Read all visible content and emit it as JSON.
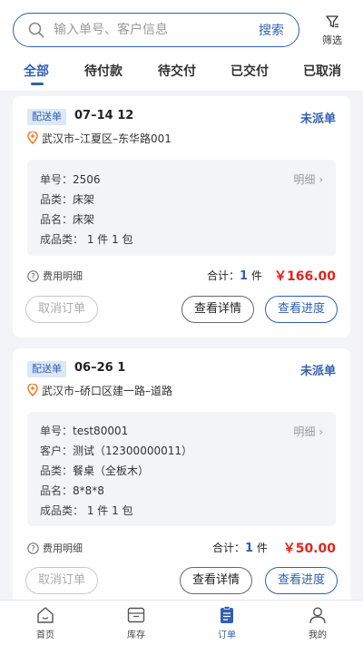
{
  "search": {
    "placeholder": "输入单号、客户信息",
    "button_label": "搜索"
  },
  "filter": {
    "label": "筛选",
    "icon": "filter-icon"
  },
  "tabs": [
    {
      "label": "全部",
      "active": true
    },
    {
      "label": "待付款",
      "active": false
    },
    {
      "label": "待交付",
      "active": false
    },
    {
      "label": "已交付",
      "active": false
    },
    {
      "label": "已取消",
      "active": false
    }
  ],
  "orders": [
    {
      "badge": "配送单",
      "date": "07–14  12",
      "status": "未派单",
      "address": "武汉市–江夏区–东华路001",
      "detail_more": "明细",
      "lines": [
        {
          "label": "单号：",
          "value": "2506"
        },
        {
          "label": "品类：",
          "value": "床架"
        },
        {
          "label": "品名：",
          "value": "床架"
        },
        {
          "label": "成品类：",
          "value": "1 件 1 包"
        }
      ],
      "fee_label": "费用明细",
      "total_label": "合计：",
      "total_count": "1",
      "total_unit": "件",
      "price": "￥166.00",
      "buttons": {
        "cancel": "取消订单",
        "view": "查看详情",
        "progress": "查看进度"
      }
    },
    {
      "badge": "配送单",
      "date": "06–26  1",
      "status": "未派单",
      "address": "武汉市–硚口区建一路–道路",
      "detail_more": "明细",
      "lines": [
        {
          "label": "单号：",
          "value": "test80001"
        },
        {
          "label": "客户：",
          "value": "测试（12300000011）"
        },
        {
          "label": "品类：",
          "value": "餐桌（全板木）"
        },
        {
          "label": "品名：",
          "value": "8*8*8"
        },
        {
          "label": "成品类：",
          "value": "1 件 1 包"
        }
      ],
      "fee_label": "费用明细",
      "total_label": "合计：",
      "total_count": "1",
      "total_unit": "件",
      "price": "￥50.00",
      "buttons": {
        "cancel": "取消订单",
        "view": "查看详情",
        "progress": "查看进度"
      }
    }
  ],
  "tabbar": [
    {
      "label": "首页",
      "icon": "home-icon",
      "active": false
    },
    {
      "label": "库存",
      "icon": "inventory-icon",
      "active": false
    },
    {
      "label": "订单",
      "icon": "order-icon",
      "active": true
    },
    {
      "label": "我的",
      "icon": "profile-icon",
      "active": false
    }
  ],
  "colors": {
    "accent": "#2f5fb3",
    "price": "#e0241b",
    "page_bg": "#f2f4f7"
  }
}
